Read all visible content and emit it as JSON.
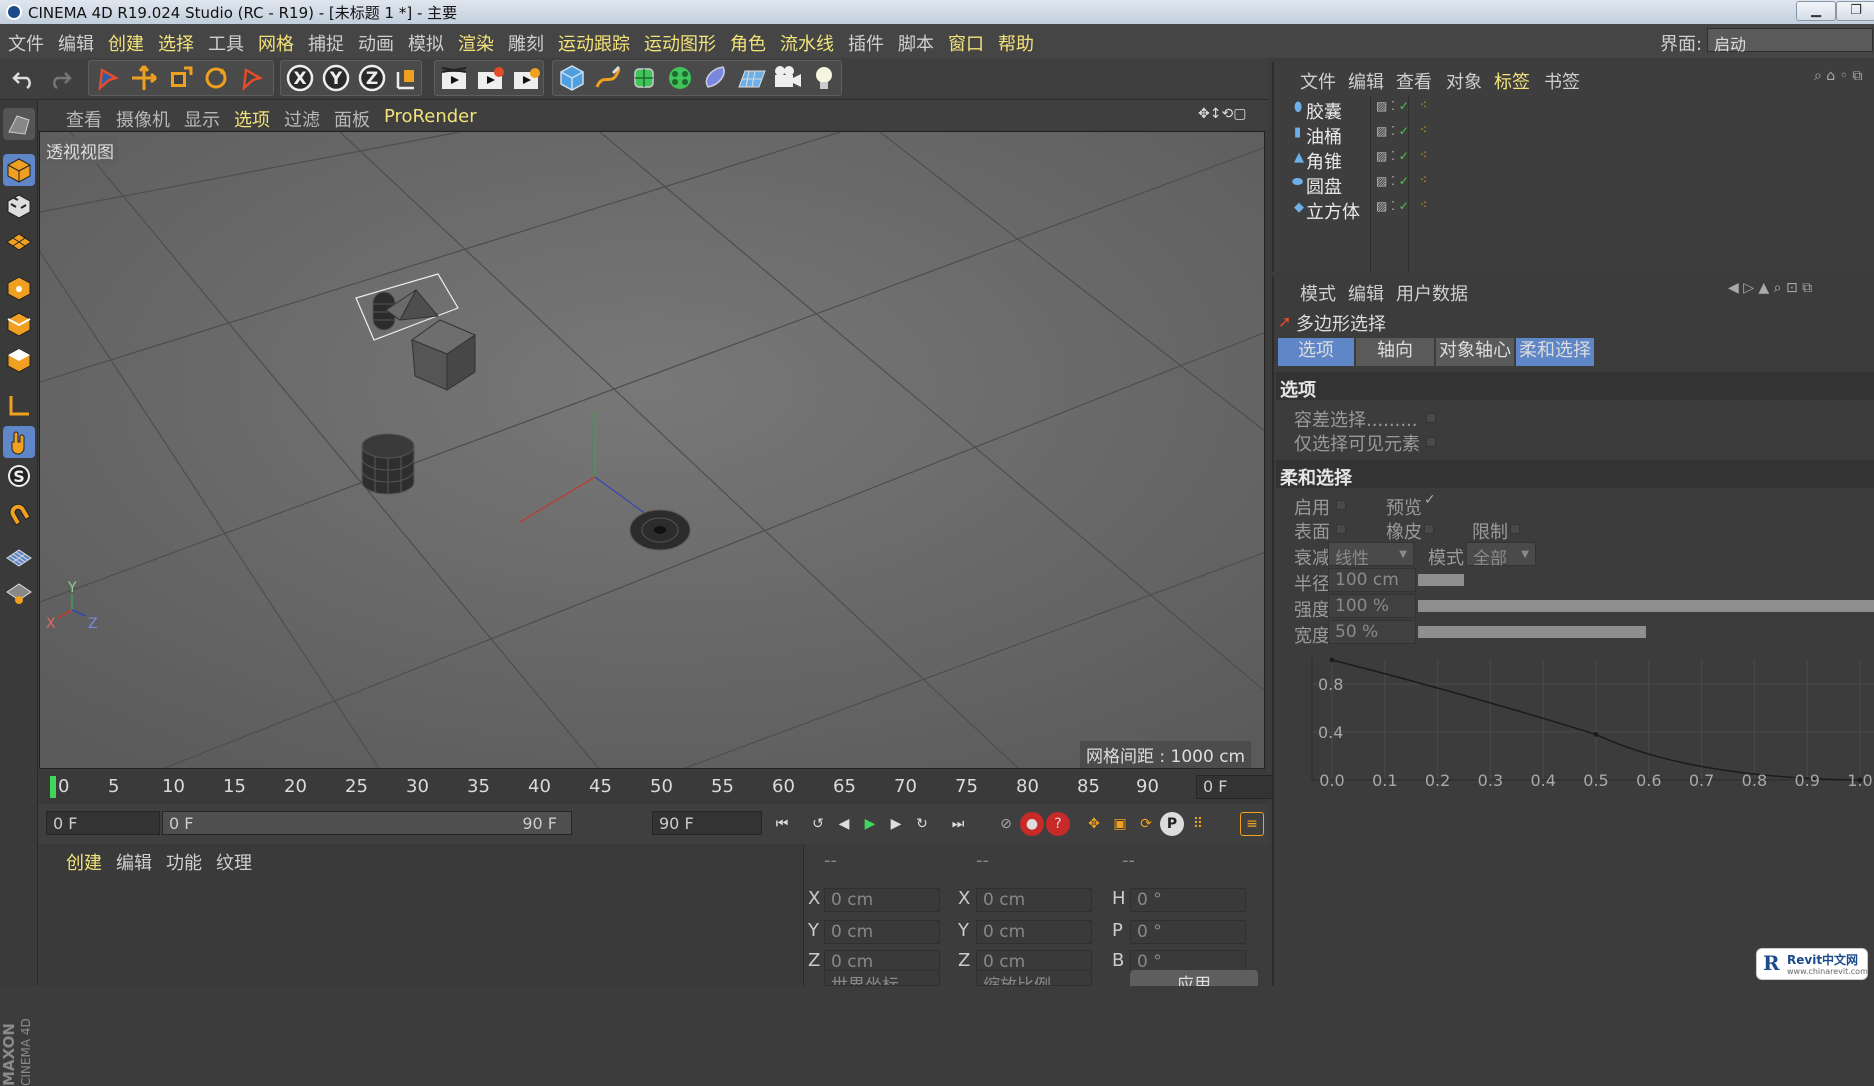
{
  "window": {
    "title": "CINEMA 4D R19.024 Studio (RC - R19) - [未标题 1 *] - 主要",
    "minimize_icon": "minimize-icon",
    "maximize_icon": "maximize-icon"
  },
  "menubar": {
    "items": [
      "文件",
      "编辑",
      "创建",
      "选择",
      "工具",
      "网格",
      "捕捉",
      "动画",
      "模拟",
      "渲染",
      "雕刻",
      "运动跟踪",
      "运动图形",
      "角色",
      "流水线",
      "插件",
      "脚本",
      "窗口",
      "帮助"
    ],
    "highlighted": [
      "创建",
      "选择",
      "网格",
      "渲染",
      "运动跟踪",
      "运动图形",
      "角色",
      "流水线",
      "窗口",
      "帮助"
    ],
    "interface_label": "界面:",
    "interface_value": "启动"
  },
  "toolbar": {
    "icons": [
      "undo-icon",
      "redo-icon",
      "live-selection-icon",
      "move-icon",
      "scale-icon",
      "rotate-icon",
      "recent-tool-icon",
      "x-axis-icon",
      "y-axis-icon",
      "z-axis-icon",
      "coordinate-system-icon",
      "render-view-icon",
      "render-picture-viewer-icon",
      "render-settings-icon",
      "cube-object-icon",
      "pen-spline-icon",
      "subdivision-icon",
      "cloner-icon",
      "deformer-icon",
      "floor-icon",
      "camera-icon",
      "light-icon"
    ],
    "axis_letters": [
      "X",
      "Y",
      "Z"
    ]
  },
  "left_toolbar": {
    "icons": [
      "make-editable-icon",
      "model-mode-icon",
      "texture-mode-icon",
      "workplane-icon",
      "points-mode-icon",
      "edges-mode-icon",
      "polygons-mode-icon",
      "axis-mode-icon",
      "tweak-mode-icon",
      "solo-icon",
      "snap-icon",
      "workplane-grid-icon",
      "locked-workplane-icon"
    ],
    "solo_letter": "S"
  },
  "viewport": {
    "menu": [
      "查看",
      "摄像机",
      "显示",
      "选项",
      "过滤",
      "面板",
      "ProRender"
    ],
    "menu_highlighted": [
      "选项",
      "ProRender"
    ],
    "label": "透视视图",
    "grid_spacing": "网格间距 : 1000 cm",
    "axis_labels": {
      "x": "X",
      "y": "Y",
      "z": "Z"
    }
  },
  "timeline": {
    "ticks": [
      "0",
      "5",
      "10",
      "15",
      "20",
      "25",
      "30",
      "35",
      "40",
      "45",
      "50",
      "55",
      "60",
      "65",
      "70",
      "75",
      "80",
      "85",
      "90"
    ],
    "current_frame": "0 F"
  },
  "transport": {
    "start": "0 F",
    "range_start": "0 F",
    "range_end": "90 F",
    "end": "90 F"
  },
  "material_panel": {
    "menu": [
      "创建",
      "编辑",
      "功能",
      "纹理"
    ]
  },
  "coord_panel": {
    "headers": [
      "--",
      "--",
      "--"
    ],
    "rows": [
      {
        "a": "X",
        "av": "0 cm",
        "b": "X",
        "bv": "0 cm",
        "c": "H",
        "cv": "0 °"
      },
      {
        "a": "Y",
        "av": "0 cm",
        "b": "Y",
        "bv": "0 cm",
        "c": "P",
        "cv": "0 °"
      },
      {
        "a": "Z",
        "av": "0 cm",
        "b": "Z",
        "bv": "0 cm",
        "c": "B",
        "cv": "0 °"
      }
    ],
    "world": "世界坐标",
    "scale": "缩放比例",
    "apply": "应用"
  },
  "object_manager": {
    "menu": [
      "文件",
      "编辑",
      "查看",
      "对象",
      "标签",
      "书签"
    ],
    "objects": [
      {
        "name": "胶囊",
        "icon": "capsule-icon"
      },
      {
        "name": "油桶",
        "icon": "oil-tank-icon"
      },
      {
        "name": "角锥",
        "icon": "pyramid-icon"
      },
      {
        "name": "圆盘",
        "icon": "disc-icon"
      },
      {
        "name": "立方体",
        "icon": "cube-icon"
      }
    ]
  },
  "attribute_manager": {
    "menu": [
      "模式",
      "编辑",
      "用户数据"
    ],
    "tool_name": "多边形选择",
    "tabs": [
      "选项",
      "轴向",
      "对象轴心",
      "柔和选择"
    ],
    "active_tabs": [
      "选项",
      "柔和选择"
    ],
    "section_options": "选项",
    "tolerance": "容差选择.........",
    "visible_only": "仅选择可见元素",
    "section_soft": "柔和选择",
    "enable": "启用",
    "preview": "预览",
    "preview_check": "✓",
    "surface": "表面",
    "rubber": "橡皮",
    "restrict": "限制",
    "falloff_label": "衰减",
    "falloff_value": "线性",
    "mode_label": "模式",
    "mode_value": "全部",
    "radius_label": "半径",
    "radius_value": "100 cm",
    "radius_fraction": 0.1,
    "strength_label": "强度",
    "strength_value": "100 %",
    "strength_fraction": 1.0,
    "width_label": "宽度",
    "width_value": "50 %",
    "width_fraction": 0.5
  },
  "chart_data": {
    "type": "line",
    "x": [
      0,
      0.5,
      1.0
    ],
    "y": [
      1.0,
      0.38,
      0.0
    ],
    "x_ticks": [
      "0.0",
      "0.1",
      "0.2",
      "0.3",
      "0.4",
      "0.5",
      "0.6",
      "0.7",
      "0.8",
      "0.9",
      "1.0"
    ],
    "y_ticks": [
      "0.8",
      "0.4"
    ],
    "xlim": [
      0,
      1
    ],
    "ylim": [
      0,
      1
    ],
    "grid": true
  },
  "watermark": {
    "brand": "Revit中文网",
    "url": "www.chinarevit.com",
    "vendor": "MAXON",
    "product": "CINEMA 4D"
  }
}
